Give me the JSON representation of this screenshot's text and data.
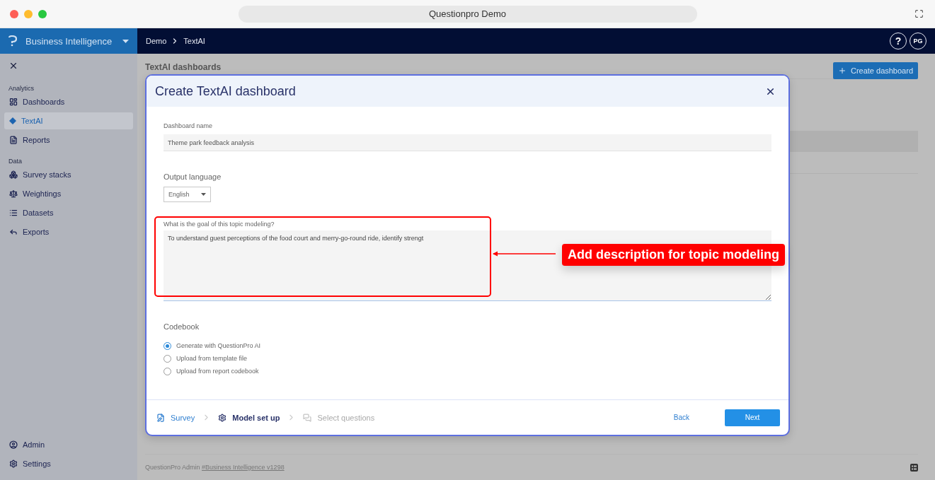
{
  "browser": {
    "title": "Questionpro Demo"
  },
  "app_header": {
    "product": "Business Intelligence",
    "breadcrumb": [
      "Demo",
      "TextAI"
    ],
    "help": "?",
    "avatar": "PG"
  },
  "sidebar": {
    "sections": [
      {
        "title": "Analytics",
        "items": [
          {
            "label": "Dashboards",
            "selected": false
          },
          {
            "label": "TextAI",
            "selected": true
          },
          {
            "label": "Reports",
            "selected": false
          }
        ]
      },
      {
        "title": "Data",
        "items": [
          {
            "label": "Survey stacks",
            "selected": false
          },
          {
            "label": "Weightings",
            "selected": false
          },
          {
            "label": "Datasets",
            "selected": false
          },
          {
            "label": "Exports",
            "selected": false
          }
        ]
      }
    ],
    "bottom_items": [
      {
        "label": "Admin",
        "selected": false
      },
      {
        "label": "Settings",
        "selected": false
      }
    ]
  },
  "page": {
    "title": "TextAI dashboards",
    "create_button": "Create dashboard",
    "footer": {
      "text": "QuestionPro Admin",
      "link": "#Business Intelligence v1298"
    }
  },
  "modal": {
    "title": "Create TextAI dashboard",
    "dashboard_name": {
      "label": "Dashboard name",
      "value": "Theme park feedback analysis"
    },
    "output_language": {
      "label": "Output language",
      "value": "English"
    },
    "goal": {
      "label": "What is the goal of this topic modeling?",
      "value": "To understand guest perceptions of the food court and merry-go-round ride, identify strengt"
    },
    "codebook": {
      "label": "Codebook",
      "options": [
        {
          "label": "Generate with QuestionPro AI",
          "selected": true
        },
        {
          "label": "Upload from template file",
          "selected": false
        },
        {
          "label": "Upload from report codebook",
          "selected": false
        }
      ]
    },
    "steps": [
      {
        "label": "Survey",
        "selected": false,
        "disabled": false
      },
      {
        "label": "Model set up",
        "selected": true,
        "disabled": false
      },
      {
        "label": "Select questions",
        "selected": false,
        "disabled": true
      }
    ],
    "back": "Back",
    "next": "Next"
  },
  "annotation": {
    "text": "Add description for topic modeling"
  }
}
